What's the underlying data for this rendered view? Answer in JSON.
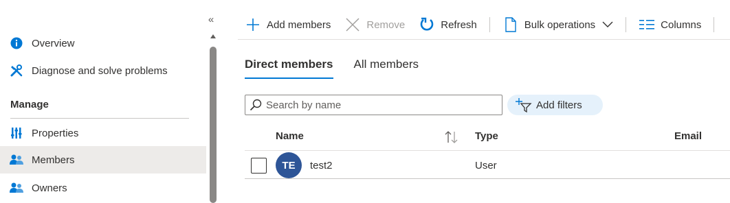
{
  "sidebar": {
    "collapse_glyph": "«",
    "items": [
      {
        "label": "Overview",
        "icon": "info-icon"
      },
      {
        "label": "Diagnose and solve problems",
        "icon": "wrench-icon"
      }
    ],
    "section_heading": "Manage",
    "manage_items": [
      {
        "label": "Properties",
        "icon": "properties-icon"
      },
      {
        "label": "Members",
        "icon": "members-icon",
        "selected": true
      },
      {
        "label": "Owners",
        "icon": "owners-icon"
      }
    ]
  },
  "toolbar": {
    "add_members_label": "Add members",
    "remove_label": "Remove",
    "refresh_label": "Refresh",
    "bulk_label": "Bulk operations",
    "columns_label": "Columns"
  },
  "tabs": [
    {
      "label": "Direct members",
      "active": true
    },
    {
      "label": "All members",
      "active": false
    }
  ],
  "search": {
    "placeholder": "Search by name",
    "value": ""
  },
  "filters": {
    "label": "Add filters"
  },
  "table": {
    "columns": [
      "Name",
      "Type",
      "Email"
    ],
    "rows": [
      {
        "initials": "TE",
        "name": "test2",
        "type": "User",
        "email": ""
      }
    ]
  },
  "colors": {
    "accent": "#0078d4",
    "avatar": "#2e5597",
    "selected_nav": "#edebe9",
    "filter_pill": "#e5f1fb"
  }
}
